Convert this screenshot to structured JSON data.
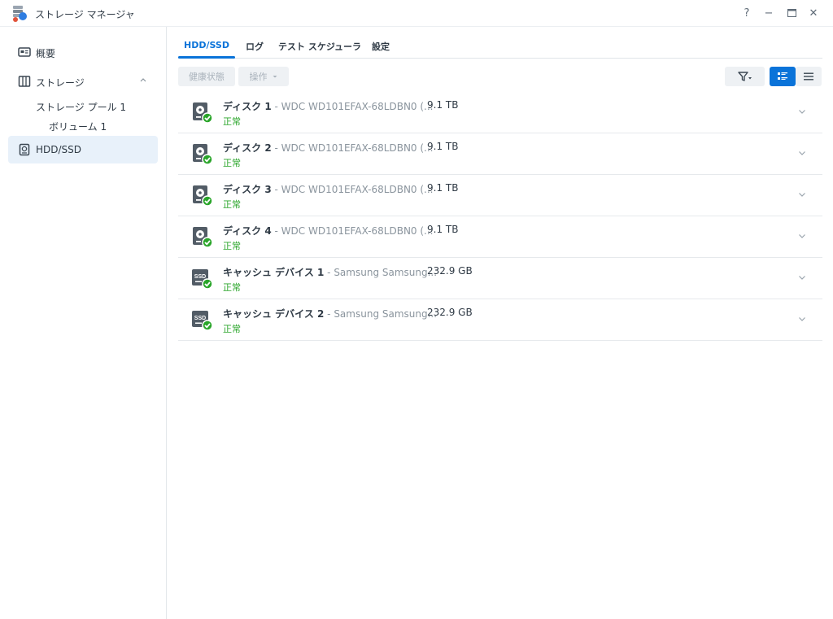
{
  "window": {
    "title": "ストレージ マネージャ",
    "controls": {
      "help": "?",
      "minimize": "−",
      "maximize": "□",
      "close": "✕"
    }
  },
  "sidebar": {
    "items": [
      {
        "label": "概要",
        "icon": "overview-icon"
      },
      {
        "label": "ストレージ",
        "icon": "storage-icon",
        "expanded": true,
        "children": [
          {
            "label": "ストレージ プール 1"
          },
          {
            "label": "ボリューム 1"
          }
        ]
      },
      {
        "label": "HDD/SSD",
        "icon": "hdd-icon",
        "active": true
      }
    ]
  },
  "tabs": [
    {
      "label": "HDD/SSD",
      "active": true
    },
    {
      "label": "ログ"
    },
    {
      "label": "テスト スケジューラ"
    },
    {
      "label": "設定"
    }
  ],
  "toolbar": {
    "health_label": "健康状態",
    "action_label": "操作",
    "filter_icon": "filter-icon",
    "view_modes": [
      "detail-view-icon",
      "list-view-icon"
    ],
    "active_view": "detail-view-icon"
  },
  "disks": [
    {
      "name": "ディスク 1",
      "model": " - WDC WD101EFAX-68LDBN0 (...",
      "capacity": "9.1 TB",
      "status": "正常",
      "type": "hdd"
    },
    {
      "name": "ディスク 2",
      "model": " - WDC WD101EFAX-68LDBN0 (...",
      "capacity": "9.1 TB",
      "status": "正常",
      "type": "hdd"
    },
    {
      "name": "ディスク 3",
      "model": " - WDC WD101EFAX-68LDBN0 (...",
      "capacity": "9.1 TB",
      "status": "正常",
      "type": "hdd"
    },
    {
      "name": "ディスク 4",
      "model": " - WDC WD101EFAX-68LDBN0 (...",
      "capacity": "9.1 TB",
      "status": "正常",
      "type": "hdd"
    },
    {
      "name": "キャッシュ デバイス 1",
      "model": " - Samsung Samsung...",
      "capacity": "232.9 GB",
      "status": "正常",
      "type": "ssd"
    },
    {
      "name": "キャッシュ デバイス 2",
      "model": " - Samsung Samsung...",
      "capacity": "232.9 GB",
      "status": "正常",
      "type": "ssd"
    }
  ],
  "ssd_icon_text": "SSD",
  "colors": {
    "accent": "#0a73d9",
    "status_ok": "#2aa52a",
    "sidebar_active_bg": "#e8f1fa"
  }
}
